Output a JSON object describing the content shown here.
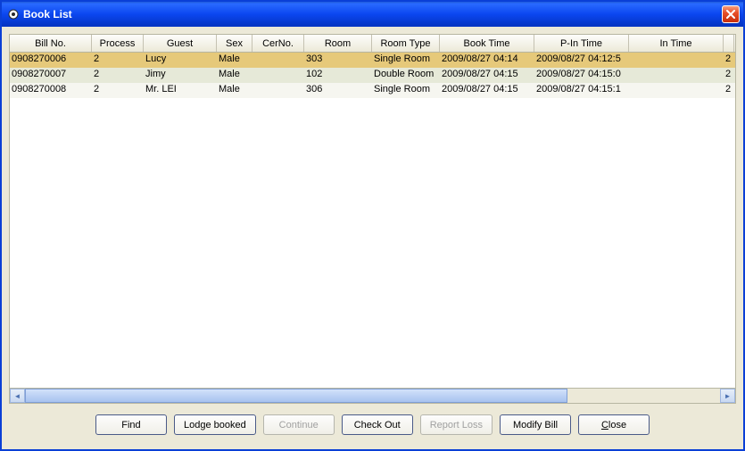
{
  "window": {
    "title": "Book List"
  },
  "columns": [
    "Bill No.",
    "Process",
    "Guest",
    "Sex",
    "CerNo.",
    "Room",
    "Room Type",
    "Book Time",
    "P-In Time",
    "In Time",
    ""
  ],
  "rows": [
    {
      "bill": "0908270006",
      "process": "2",
      "guest": "Lucy",
      "sex": "Male",
      "cerno": "",
      "room": "303",
      "roomtype": "Single Room",
      "booktime": "2009/08/27 04:14",
      "pintime": "2009/08/27 04:12:5",
      "intime": "",
      "extra": "2",
      "style": "selected"
    },
    {
      "bill": "0908270007",
      "process": "2",
      "guest": "Jimy",
      "sex": "Male",
      "cerno": "",
      "room": "102",
      "roomtype": "Double Room",
      "booktime": "2009/08/27 04:15",
      "pintime": "2009/08/27 04:15:0",
      "intime": "",
      "extra": "2",
      "style": "alt"
    },
    {
      "bill": "0908270008",
      "process": "2",
      "guest": "Mr. LEI",
      "sex": "Male",
      "cerno": "",
      "room": "306",
      "roomtype": "Single Room",
      "booktime": "2009/08/27 04:15",
      "pintime": "2009/08/27 04:15:1",
      "intime": "",
      "extra": "2",
      "style": "norm"
    }
  ],
  "buttons": {
    "find": "Find",
    "lodge": "Lodge booked",
    "continue": "Continue",
    "checkout": "Check Out",
    "reportloss": "Report Loss",
    "modify": "Modify Bill",
    "close_prefix": "",
    "close_ul": "C",
    "close_suffix": "lose"
  }
}
